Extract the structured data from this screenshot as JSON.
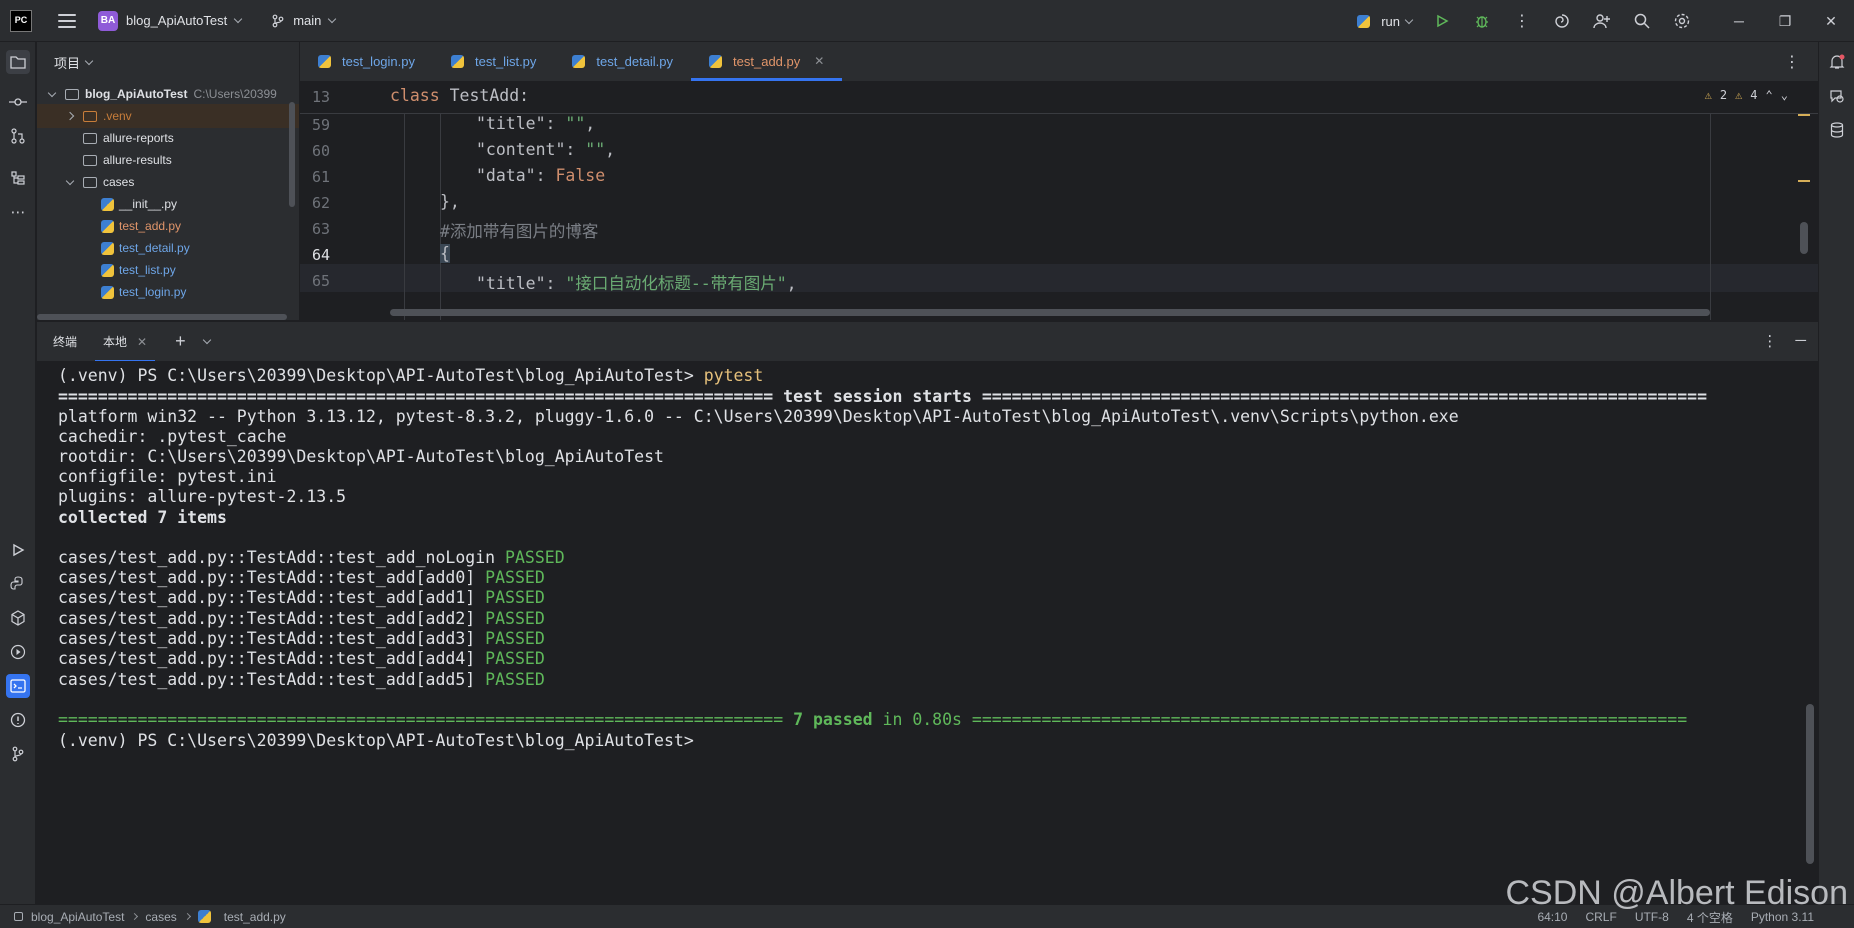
{
  "titlebar": {
    "logo": "PC",
    "project_badge": "BA",
    "project_name": "blog_ApiAutoTest",
    "branch": "main",
    "run_config": "run"
  },
  "project_panel": {
    "title": "项目",
    "root_name": "blog_ApiAutoTest",
    "root_path": "C:\\Users\\20399",
    "items": [
      {
        "label": ".venv"
      },
      {
        "label": "allure-reports"
      },
      {
        "label": "allure-results"
      },
      {
        "label": "cases"
      },
      {
        "label": "__init__.py"
      },
      {
        "label": "test_add.py"
      },
      {
        "label": "test_detail.py"
      },
      {
        "label": "test_list.py"
      },
      {
        "label": "test_login.py"
      }
    ]
  },
  "tabs": [
    {
      "label": "test_login.py"
    },
    {
      "label": "test_list.py"
    },
    {
      "label": "test_detail.py"
    },
    {
      "label": "test_add.py"
    }
  ],
  "editor": {
    "sticky_line_no": "13",
    "sticky_kw": "class",
    "sticky_name": " TestAdd:",
    "warnings_count": "2",
    "weak_warnings_count": "4",
    "lines": [
      {
        "no": "59",
        "k": "\"title\"",
        "p": ": ",
        "v": "\"\"",
        "e": ","
      },
      {
        "no": "60",
        "k": "\"content\"",
        "p": ": ",
        "v": "\"\"",
        "e": ","
      },
      {
        "no": "61",
        "k": "\"data\"",
        "p": ": ",
        "v": "False",
        "e": ""
      },
      {
        "no": "62",
        "text": "},"
      },
      {
        "no": "63",
        "comment": "#添加带有图片的博客"
      },
      {
        "no": "64",
        "text": "{"
      },
      {
        "no": "65",
        "k": "\"title\"",
        "p": ": ",
        "v": "\"接口自动化标题--带有图片\"",
        "e": ","
      }
    ]
  },
  "terminal": {
    "label": "终端",
    "tab": "本地",
    "prompt": "(.venv) PS C:\\Users\\20399\\Desktop\\API-AutoTest\\blog_ApiAutoTest>",
    "command": " pytest",
    "session_sep_left": "========================================================================",
    "session_title": " test session starts ",
    "session_sep_right": "=========================================================================",
    "platform": "platform win32 -- Python 3.13.12, pytest-8.3.2, pluggy-1.6.0 -- C:\\Users\\20399\\Desktop\\API-AutoTest\\blog_ApiAutoTest\\.venv\\Scripts\\python.exe",
    "cachedir": "cachedir: .pytest_cache",
    "rootdir": "rootdir: C:\\Users\\20399\\Desktop\\API-AutoTest\\blog_ApiAutoTest",
    "configfile": "configfile: pytest.ini",
    "plugins": "plugins: allure-pytest-2.13.5",
    "collected": "collected 7 items",
    "results": [
      {
        "test": "cases/test_add.py::TestAdd::test_add_noLogin ",
        "status": "PASSED"
      },
      {
        "test": "cases/test_add.py::TestAdd::test_add[add0] ",
        "status": "PASSED"
      },
      {
        "test": "cases/test_add.py::TestAdd::test_add[add1] ",
        "status": "PASSED"
      },
      {
        "test": "cases/test_add.py::TestAdd::test_add[add2] ",
        "status": "PASSED"
      },
      {
        "test": "cases/test_add.py::TestAdd::test_add[add3] ",
        "status": "PASSED"
      },
      {
        "test": "cases/test_add.py::TestAdd::test_add[add4] ",
        "status": "PASSED"
      },
      {
        "test": "cases/test_add.py::TestAdd::test_add[add5] ",
        "status": "PASSED"
      }
    ],
    "summary_sep_left": "=========================================================================",
    "summary_passed": " 7 passed",
    "summary_time": " in 0.80s ",
    "summary_sep_right": "========================================================================",
    "final_prompt": "(.venv) PS C:\\Users\\20399\\Desktop\\API-AutoTest\\blog_ApiAutoTest>"
  },
  "statusbar": {
    "crumbs": [
      "blog_ApiAutoTest",
      "cases",
      "test_add.py"
    ],
    "position": "64:10",
    "line_sep": "CRLF",
    "encoding": "UTF-8",
    "indent": "4 个空格",
    "interpreter": "Python 3.11"
  },
  "watermark": "CSDN @Albert Edison",
  "colors": {
    "accent": "#3574f0",
    "passed": "#5fb85a",
    "command": "#e5c07b",
    "active_tab": "#e0956a",
    "tab_text": "#6ea6e8"
  }
}
